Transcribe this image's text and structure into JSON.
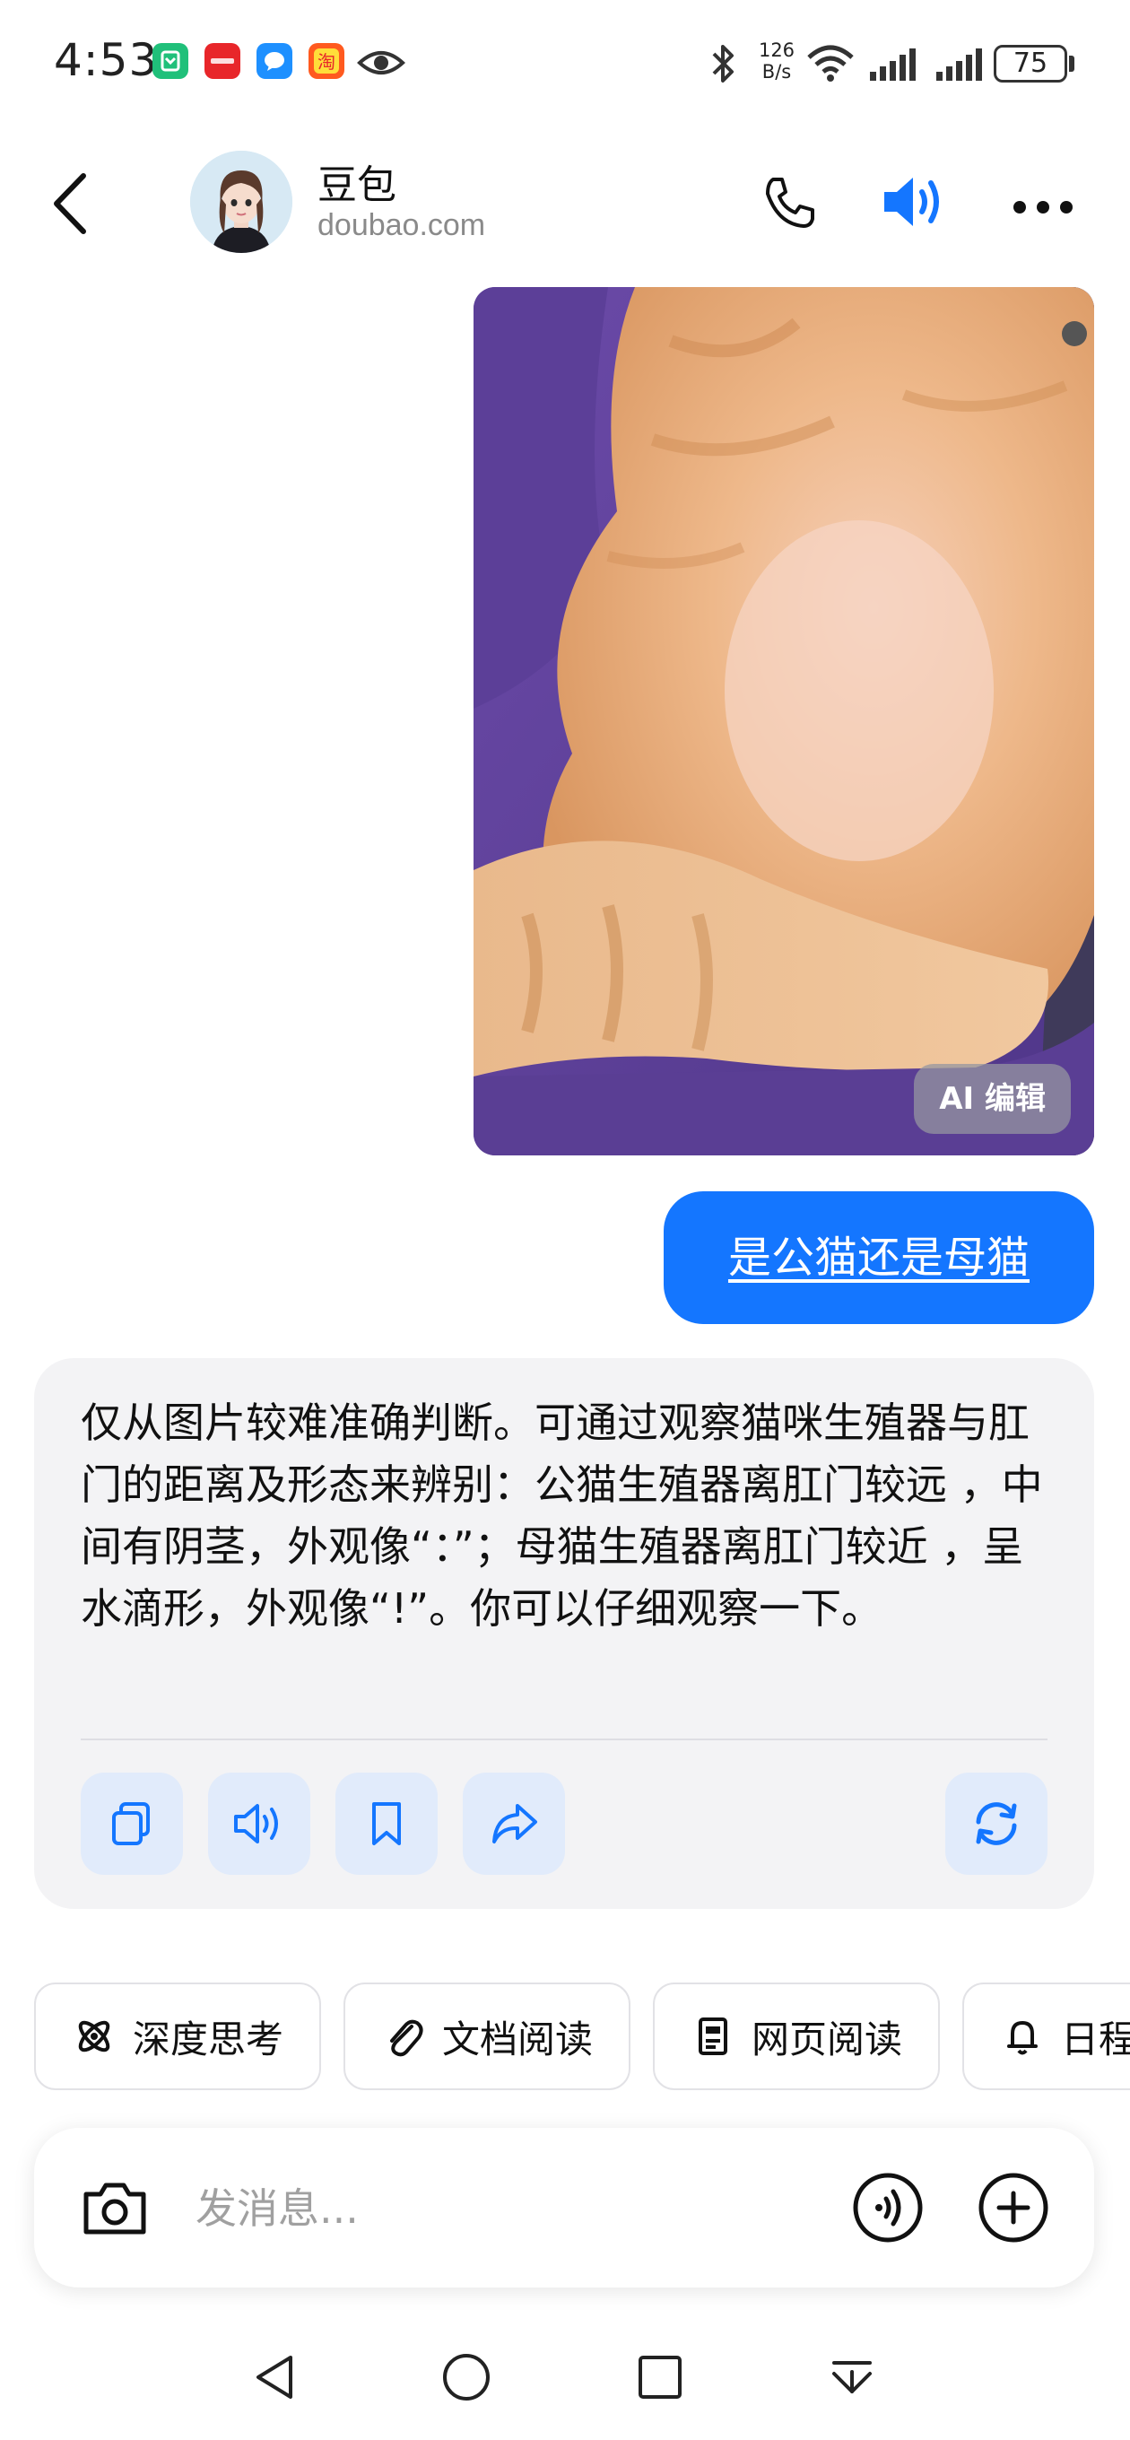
{
  "status_bar": {
    "time": "4:53",
    "net_speed_value": "126",
    "net_speed_unit": "B/s",
    "battery": "75",
    "app_icons": [
      {
        "name": "messaging-app-icon",
        "color": "#20c07a"
      },
      {
        "name": "huawei-app-icon",
        "color": "#e8262a"
      },
      {
        "name": "chat-app-icon",
        "color": "#1e90ff"
      },
      {
        "name": "taobao-app-icon",
        "color": "#ff5a1f"
      }
    ]
  },
  "header": {
    "name": "豆包",
    "domain": "doubao.com"
  },
  "messages": {
    "image": {
      "ai_edit_label": "AI 编辑"
    },
    "user_text": "是公猫还是母猫",
    "ai_reply": "仅从图片较难准确判断。可通过观察猫咪生殖器与肛门的距离及形态来辨别：公猫生殖器离肛门较远 ，中间有阴茎，外观像“：”；母猫生殖器离肛门较近 ，呈水滴形，外观像“!”。你可以仔细观察一下。"
  },
  "chips": [
    {
      "label": "深度思考",
      "icon": "atom-icon"
    },
    {
      "label": "文档阅读",
      "icon": "paperclip-icon"
    },
    {
      "label": "网页阅读",
      "icon": "document-icon"
    },
    {
      "label": "日程",
      "icon": "bell-icon"
    }
  ],
  "input": {
    "placeholder": "发消息..."
  },
  "colors": {
    "accent": "#1476ff",
    "card_bg": "#f3f3f5",
    "action_bg": "#e1ebfb"
  }
}
